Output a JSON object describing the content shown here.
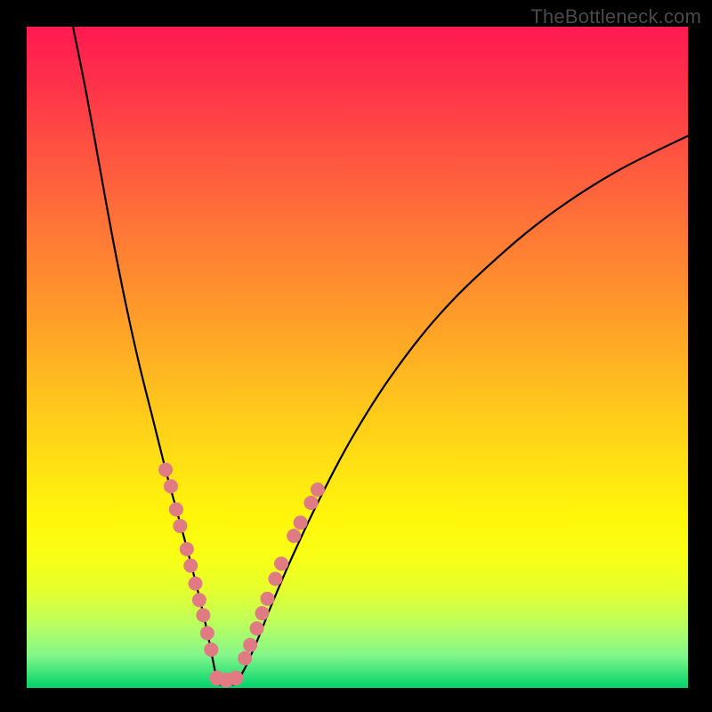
{
  "watermark": "TheBottleneck.com",
  "colors": {
    "frame_background": "#000000",
    "curve_stroke": "#000000",
    "dot_fill": "#e07b83",
    "gradient_top": "#ff1a51",
    "gradient_mid": "#ffd814",
    "gradient_bottom": "#00d36b"
  },
  "chart_data": {
    "type": "line",
    "title": "",
    "xlabel": "",
    "ylabel": "",
    "xlim": [
      0,
      100
    ],
    "ylim": [
      0,
      100
    ],
    "left_curve": {
      "x": [
        7,
        9,
        11,
        13,
        15,
        17,
        19,
        21,
        22.5,
        24,
        25.3,
        26.4,
        27.3,
        28,
        28.5,
        29
      ],
      "y": [
        100,
        90,
        79,
        68,
        58,
        49,
        41,
        33,
        27.5,
        22,
        17,
        12.5,
        8.5,
        5,
        2.5,
        0.5
      ]
    },
    "right_curve": {
      "x": [
        31.5,
        33,
        35,
        37,
        40,
        44,
        49,
        55,
        62,
        70,
        79,
        89,
        100
      ],
      "y": [
        0.5,
        3,
        7.5,
        12.5,
        19.5,
        28,
        37.5,
        47,
        56,
        64,
        71.5,
        78,
        83.5
      ]
    },
    "floor_segment": {
      "x": [
        29,
        31.5
      ],
      "y": [
        0.5,
        0.5
      ]
    },
    "dots_left": [
      {
        "x": 21.0,
        "y": 33.0
      },
      {
        "x": 21.8,
        "y": 30.5
      },
      {
        "x": 22.6,
        "y": 27.0
      },
      {
        "x": 23.2,
        "y": 24.5
      },
      {
        "x": 24.2,
        "y": 21.0
      },
      {
        "x": 24.8,
        "y": 18.5
      },
      {
        "x": 25.5,
        "y": 15.8
      },
      {
        "x": 26.1,
        "y": 13.3
      },
      {
        "x": 26.7,
        "y": 11.0
      },
      {
        "x": 27.3,
        "y": 8.3
      },
      {
        "x": 27.9,
        "y": 5.8
      }
    ],
    "dots_bottom": [
      {
        "x": 28.8,
        "y": 1.5
      },
      {
        "x": 30.2,
        "y": 1.2
      },
      {
        "x": 31.6,
        "y": 1.5
      }
    ],
    "dots_right": [
      {
        "x": 33.0,
        "y": 4.5
      },
      {
        "x": 33.8,
        "y": 6.5
      },
      {
        "x": 34.8,
        "y": 9.0
      },
      {
        "x": 35.6,
        "y": 11.3
      },
      {
        "x": 36.4,
        "y": 13.5
      },
      {
        "x": 37.6,
        "y": 16.5
      },
      {
        "x": 38.5,
        "y": 18.8
      },
      {
        "x": 40.4,
        "y": 23.0
      },
      {
        "x": 41.4,
        "y": 25.0
      },
      {
        "x": 43.0,
        "y": 28.0
      },
      {
        "x": 44.0,
        "y": 30.0
      }
    ]
  }
}
